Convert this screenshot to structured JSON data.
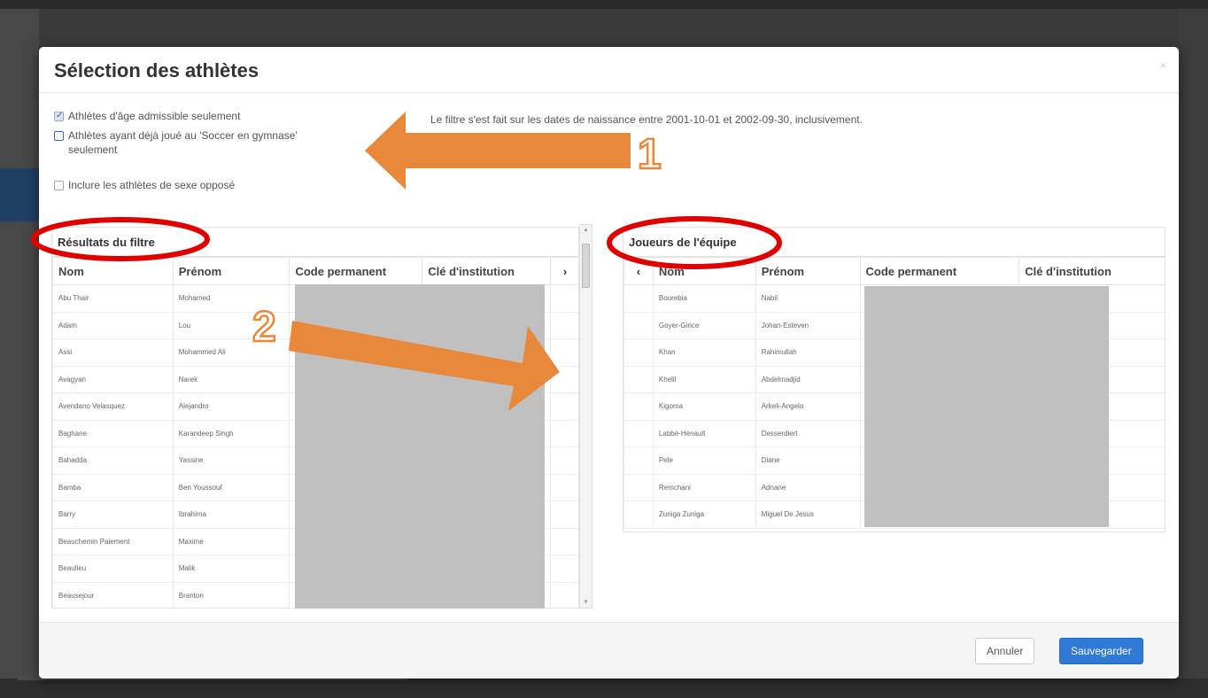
{
  "modal": {
    "title": "Sélection des athlètes",
    "close_icon": "close-icon",
    "close_label": "×"
  },
  "filters": {
    "items": [
      {
        "label": "Athlètes d'âge admissible seulement",
        "checked": true
      },
      {
        "label": "Athlètes ayant déjà joué au 'Soccer en gymnase'",
        "label_cont": "seulement",
        "checked": false
      },
      {
        "label": "Inclure les athlètes de sexe opposé",
        "checked": false
      }
    ],
    "info": "Le filtre s'est fait sur les dates de naissance entre 2001-10-01 et 2002-09-30, inclusivement."
  },
  "left_panel": {
    "title": "Résultats du filtre",
    "columns": [
      "Nom",
      "Prénom",
      "Code permanent",
      "Clé d'institution"
    ],
    "move_icon": "chevron-right-icon",
    "move_label": "›",
    "rows": [
      {
        "nom": "Abu Thair",
        "prenom": "Mohamed"
      },
      {
        "nom": "Adam",
        "prenom": "Lou"
      },
      {
        "nom": "Assi",
        "prenom": "Mohammed Ali"
      },
      {
        "nom": "Avagyan",
        "prenom": "Narek"
      },
      {
        "nom": "Avendano Velasquez",
        "prenom": "Alejandro"
      },
      {
        "nom": "Baghane",
        "prenom": "Karandeep Singh"
      },
      {
        "nom": "Bahadda",
        "prenom": "Yassine"
      },
      {
        "nom": "Bamba",
        "prenom": "Ben Youssouf"
      },
      {
        "nom": "Barry",
        "prenom": "Ibrahima"
      },
      {
        "nom": "Beauchemin Paiement",
        "prenom": "Maxime"
      },
      {
        "nom": "Beaulieu",
        "prenom": "Malik"
      },
      {
        "nom": "Beausejour",
        "prenom": "Branton"
      }
    ]
  },
  "right_panel": {
    "title": "Joueurs de l'équipe",
    "columns": [
      "Nom",
      "Prénom",
      "Code permanent",
      "Clé d'institution"
    ],
    "move_icon": "chevron-left-icon",
    "move_label": "‹",
    "rows": [
      {
        "nom": "Bourebia",
        "prenom": "Nabil"
      },
      {
        "nom": "Goyer-Girice",
        "prenom": "Johan-Esteven"
      },
      {
        "nom": "Khan",
        "prenom": "Rahimullah"
      },
      {
        "nom": "Khelil",
        "prenom": "Abdelmadjid"
      },
      {
        "nom": "Kigoma",
        "prenom": "Arkeli-Angelo"
      },
      {
        "nom": "Labbé-Hénault",
        "prenom": "Desserdiert"
      },
      {
        "nom": "Pele",
        "prenom": "Diane"
      },
      {
        "nom": "Remchani",
        "prenom": "Adnane"
      },
      {
        "nom": "Zuniga Zuniga",
        "prenom": "Miguel De Jesus"
      }
    ]
  },
  "footer": {
    "cancel_label": "Annuler",
    "save_label": "Sauvegarder"
  },
  "annotations": {
    "marker_1": "1",
    "marker_2": "2",
    "arrow_color": "#e8883a",
    "circle_color": "#e10000"
  }
}
